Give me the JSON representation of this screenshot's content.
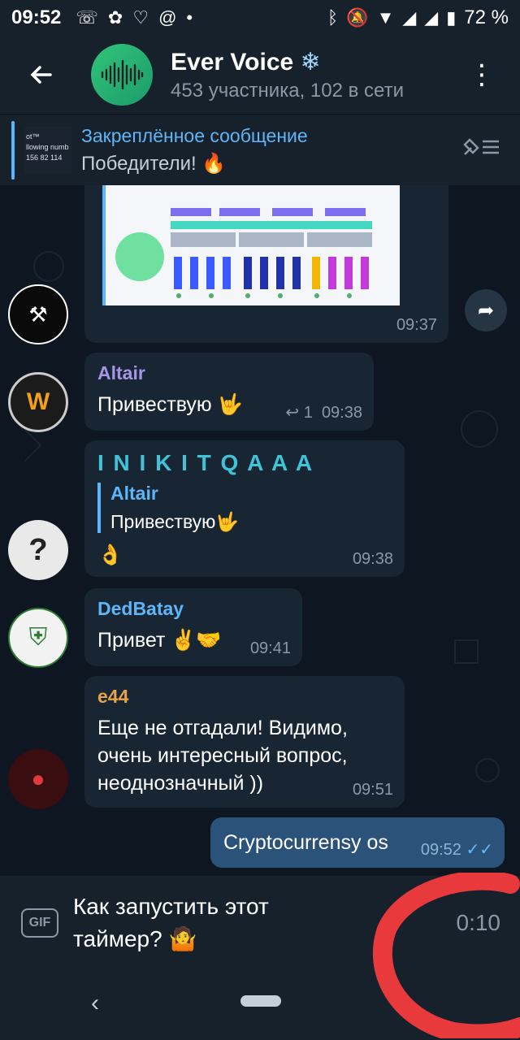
{
  "status_bar": {
    "time": "09:52",
    "battery": "72 %"
  },
  "header": {
    "title": "Ever Voice",
    "subtitle": "453 участника, 102 в сети"
  },
  "pinned": {
    "title": "Закреплённое сообщение",
    "message": "Победители! 🔥",
    "thumb_lines": [
      "ot™",
      "llowing numb",
      "156 82 114"
    ]
  },
  "messages": [
    {
      "id": "img",
      "time": "09:37"
    },
    {
      "id": "altair",
      "sender": "Altair",
      "sender_color": "#a695e7",
      "text": "Привествую 🤟",
      "reply_count": "1",
      "time": "09:38"
    },
    {
      "id": "inikit",
      "sender": "I N I K I T Q A A A",
      "sender_color": "#40c3d9",
      "quote_name": "Altair",
      "quote_text": "Привествую🤟",
      "text": "👌",
      "time": "09:38"
    },
    {
      "id": "dedbatay",
      "sender": "DedBatay",
      "sender_color": "#5eb5f7",
      "text": "Привет ✌️🤝",
      "time": "09:41"
    },
    {
      "id": "e44",
      "sender": "e44",
      "sender_color": "#e8a24a",
      "text": "Еще не отгадали! Видимо, очень интересный вопрос, неоднозначный ))",
      "time": "09:51"
    },
    {
      "id": "outgoing",
      "text": "Cryptocurrensy os",
      "time": "09:52"
    }
  ],
  "input": {
    "gif_label": "GIF",
    "text": "Как запустить этот таймер? 🤷",
    "timer": "0:10"
  },
  "colors": {
    "accent": "#5eb5f7",
    "annotation": "#e8393d"
  }
}
